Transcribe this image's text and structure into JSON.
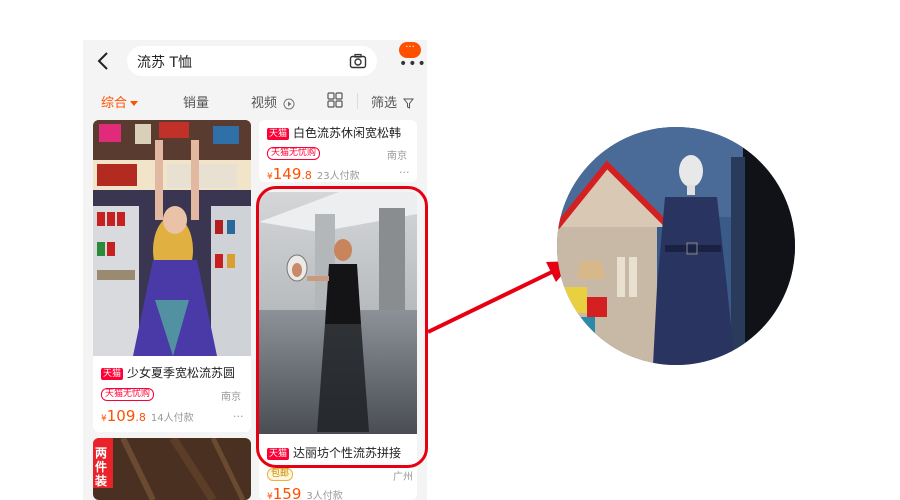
{
  "search": {
    "query": "流苏 T恤",
    "notification_count": "···"
  },
  "filters": {
    "comprehensive": "综合",
    "sales": "销量",
    "video": "视频",
    "filter": "筛选"
  },
  "products": [
    {
      "store_tag": "天猫",
      "title": "少女夏季宽松流苏圆",
      "promo": "天猫无忧购",
      "location": "南京",
      "currency": "¥",
      "price_int": "109",
      "price_dec": ".8",
      "sold": "14人付款",
      "more": "···"
    },
    {
      "store_tag": "天猫",
      "title": "白色流苏休闲宽松韩",
      "promo": "天猫无忧购",
      "location": "南京",
      "currency": "¥",
      "price_int": "149",
      "price_dec": ".8",
      "sold": "23人付款",
      "more": "···"
    },
    {
      "store_tag": "天猫",
      "title": "达丽坊个性流苏拼接",
      "promo": "包邮",
      "location": "广州",
      "currency": "¥",
      "price_int": "159",
      "price_dec": "",
      "sold": "3人付款",
      "more": "···"
    }
  ],
  "banner_tag": "两件装",
  "colors": {
    "accent": "#ff5000",
    "tmall_red": "#ff0036",
    "highlight_red": "#e60012"
  }
}
